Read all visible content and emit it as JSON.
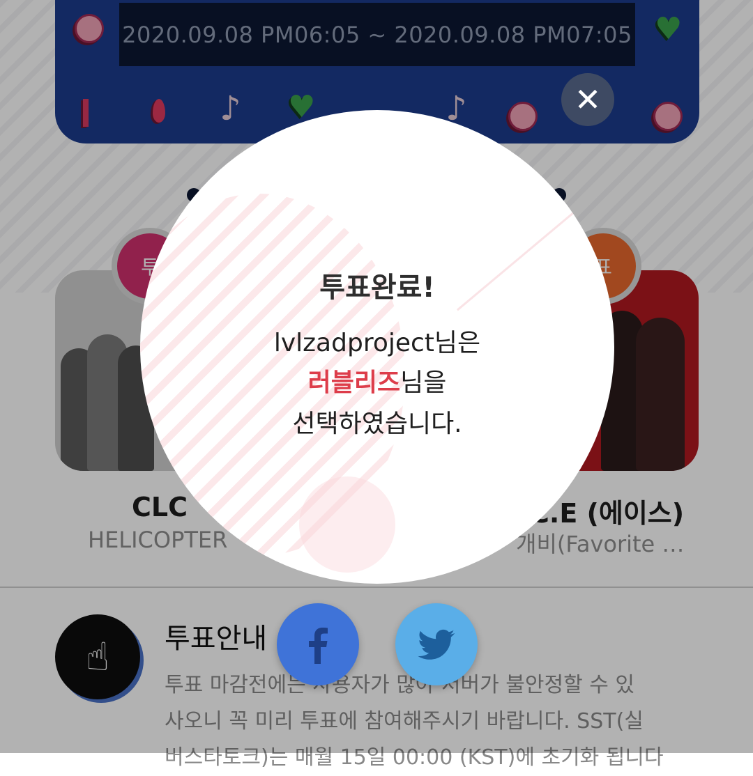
{
  "banner": {
    "time_range": "2020.09.08 PM06:05 ~ 2020.09.08 PM07:05"
  },
  "candidates": [
    {
      "vote_label": "투",
      "name": "CLC",
      "song": "HELICOPTER"
    },
    {
      "vote_label": "표",
      "name": "C.E (에이스)",
      "song": "개비(Favorite …"
    }
  ],
  "guide": {
    "title": "투표안내",
    "lines": [
      "투표 마감전에는 사용자가 많아 서버가 불안정할 수 있",
      "사오니 꼭 미리 투표에 참여해주시기 바랍니다. SST(실",
      "버스타토크)는 매월 15일 00:00 (KST)에 초기화 됩니다"
    ]
  },
  "modal": {
    "title": "투표완료!",
    "username": "lvlzadproject",
    "suffix1": "님은",
    "choice": "러블리즈",
    "suffix2": "님을",
    "line3": "선택하였습니다."
  },
  "share": {
    "facebook_icon": "facebook-icon",
    "twitter_icon": "twitter-icon"
  },
  "colors": {
    "banner": "#1c3b8d",
    "highlight": "#dd3d4a",
    "facebook": "#3f73d8",
    "twitter": "#5aaee8"
  }
}
